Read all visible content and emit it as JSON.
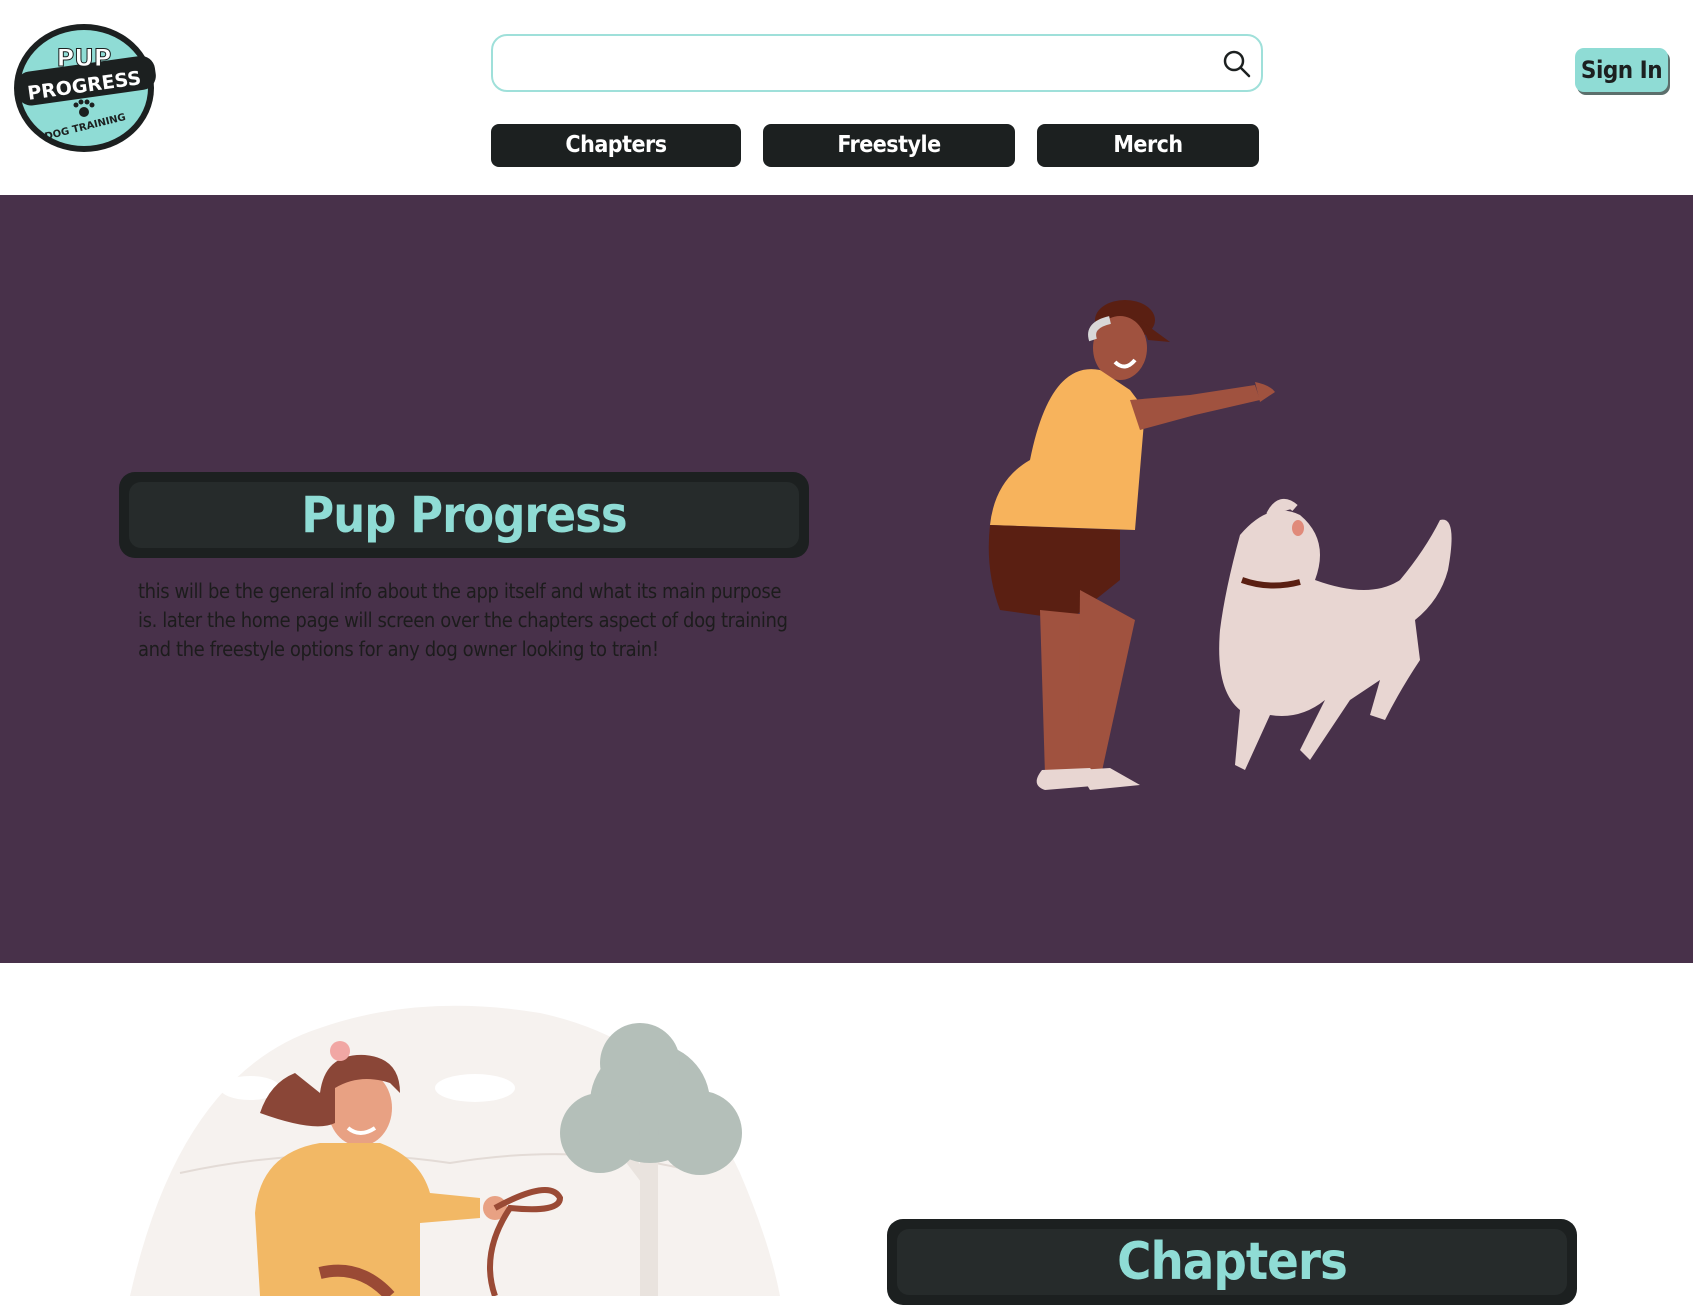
{
  "header": {
    "logo": {
      "line1": "PUP",
      "line2": "PROGRESS",
      "line3": "DOG TRAINING"
    },
    "search": {
      "value": "",
      "placeholder": "",
      "icon": "search-icon"
    },
    "nav": [
      {
        "label": "Chapters"
      },
      {
        "label": "Freestyle"
      },
      {
        "label": "Merch"
      }
    ],
    "sign_in_label": "Sign In"
  },
  "hero": {
    "title": "Pup Progress",
    "description": "this will be the general info about the app itself and what its main purpose is. later the home page will screen over the chapters aspect of dog training and the freestyle options for any dog owner looking to train!",
    "illustration": "man-playing-with-dog-illustration"
  },
  "chapters_section": {
    "title": "Chapters",
    "illustration": "woman-with-leash-illustration"
  },
  "colors": {
    "accent": "#8fdcd5",
    "dark": "#1c2020",
    "hero_bg": "#48314a",
    "search_border": "#9fe0da"
  }
}
